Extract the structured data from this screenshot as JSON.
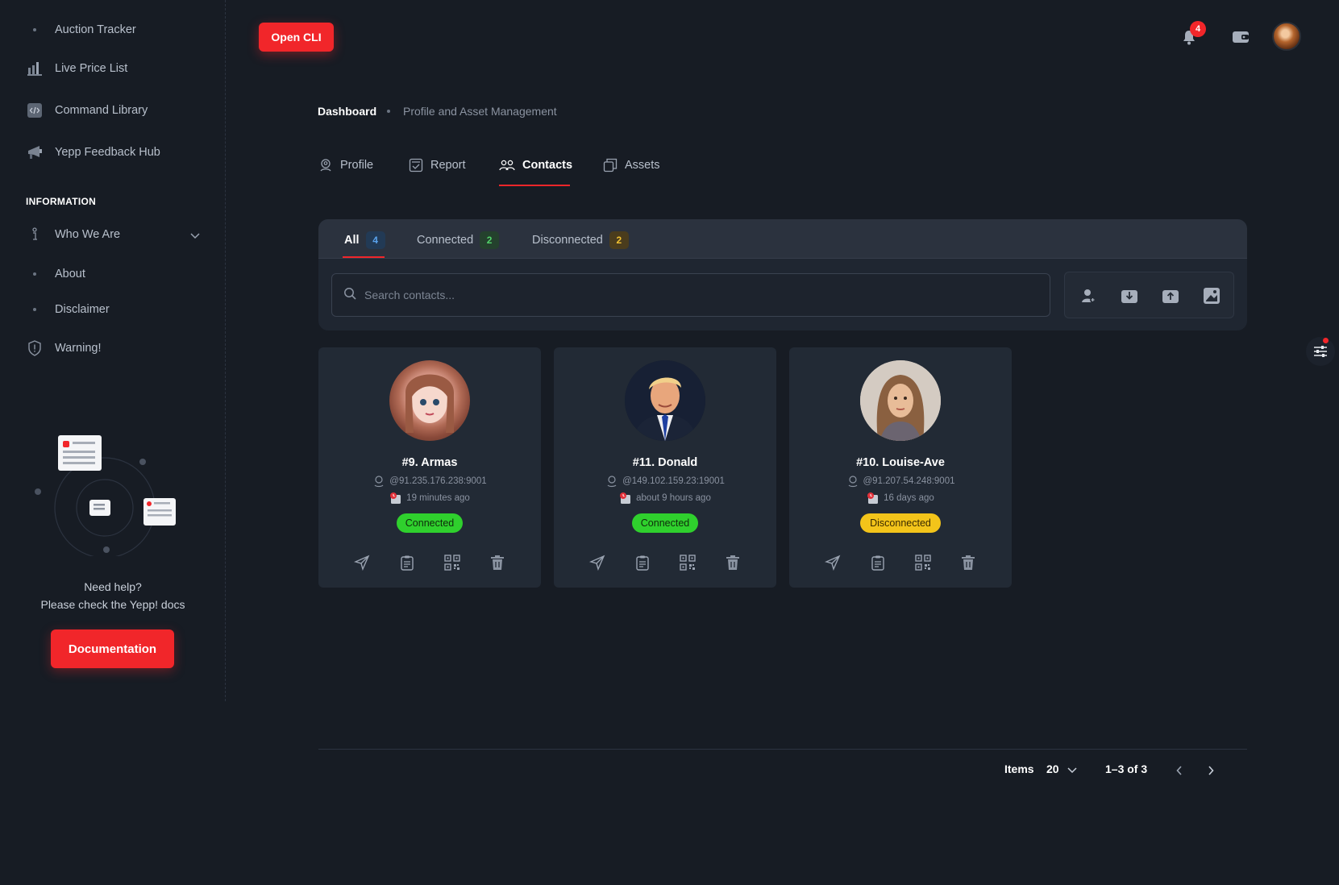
{
  "sidebar": {
    "items": [
      {
        "label": "Auction Tracker",
        "icon": "dot-icon"
      },
      {
        "label": "Live Price List",
        "icon": "bar-chart-icon"
      },
      {
        "label": "Command Library",
        "icon": "code-icon"
      },
      {
        "label": "Yepp Feedback Hub",
        "icon": "megaphone-icon"
      }
    ],
    "section_title": "INFORMATION",
    "info_items": [
      {
        "label": "Who We Are",
        "icon": "info-icon"
      },
      {
        "label": "About",
        "icon": "dot-icon"
      },
      {
        "label": "Disclaimer",
        "icon": "dot-icon"
      },
      {
        "label": "Warning!",
        "icon": "shield-icon"
      }
    ],
    "help_line1": "Need help?",
    "help_line2": "Please check the Yepp! docs",
    "doc_button": "Documentation"
  },
  "header": {
    "open_cli": "Open CLI",
    "notification_count": "4"
  },
  "breadcrumb": {
    "root": "Dashboard",
    "current": "Profile and Asset Management"
  },
  "tabs": [
    {
      "label": "Profile",
      "icon": "profile-icon"
    },
    {
      "label": "Report",
      "icon": "report-icon"
    },
    {
      "label": "Contacts",
      "icon": "contacts-icon",
      "active": true
    },
    {
      "label": "Assets",
      "icon": "assets-icon"
    }
  ],
  "filters": [
    {
      "label": "All",
      "count": "4",
      "color": "#5aa4ee",
      "active": true
    },
    {
      "label": "Connected",
      "count": "2",
      "color": "#52d36a"
    },
    {
      "label": "Disconnected",
      "count": "2",
      "color": "#f2c232"
    }
  ],
  "search": {
    "placeholder": "Search contacts..."
  },
  "contacts": [
    {
      "name": "#9. Armas",
      "address": "@91.235.176.238:9001",
      "time": "19 minutes ago",
      "status": "Connected"
    },
    {
      "name": "#11. Donald",
      "address": "@149.102.159.23:19001",
      "time": "about 9 hours ago",
      "status": "Connected"
    },
    {
      "name": "#10. Louise-Ave",
      "address": "@91.207.54.248:9001",
      "time": "16 days ago",
      "status": "Disconnected"
    }
  ],
  "pagination": {
    "items_label": "Items",
    "page_size": "20",
    "range": "1–3 of 3"
  },
  "colors": {
    "accent": "#f1262a",
    "connected": "#2fd02d",
    "disconnected": "#f3c41a",
    "background": "#171c24"
  }
}
